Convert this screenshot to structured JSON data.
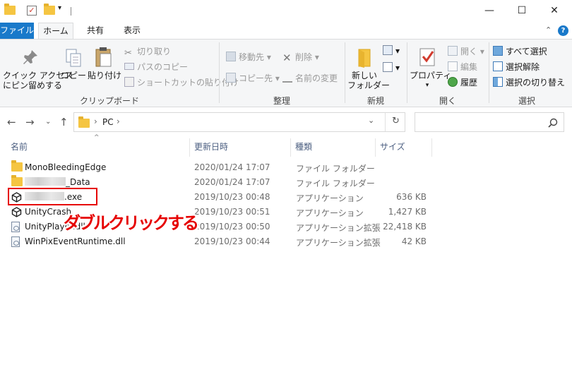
{
  "window": {
    "minimize": "—",
    "maximize": "☐",
    "close": "✕"
  },
  "ribbon_tabs": {
    "file": "ファイル",
    "home": "ホーム",
    "share": "共有",
    "view": "表示",
    "expand": "⌃",
    "help": "?"
  },
  "ribbon": {
    "clipboard": {
      "label": "クリップボード",
      "pin_line1": "クイック アクセス",
      "pin_line2": "にピン留めする",
      "copy": "コピー",
      "paste": "貼り付け",
      "cut": "切り取り",
      "copy_path": "パスのコピー",
      "paste_shortcut": "ショートカットの貼り付け"
    },
    "organize": {
      "label": "整理",
      "move_to": "移動先",
      "copy_to": "コピー先",
      "delete": "削除",
      "rename": "名前の変更"
    },
    "new": {
      "label": "新規",
      "new_folder_line1": "新しい",
      "new_folder_line2": "フォルダー"
    },
    "open": {
      "label": "開く",
      "properties": "プロパティ",
      "open": "開く",
      "edit": "編集",
      "history": "履歴"
    },
    "select": {
      "label": "選択",
      "select_all": "すべて選択",
      "select_none": "選択解除",
      "invert": "選択の切り替え"
    }
  },
  "address": {
    "location": "PC",
    "separator": "›",
    "search_placeholder": ""
  },
  "columns": {
    "name": "名前",
    "modified": "更新日時",
    "type": "種類",
    "size": "サイズ"
  },
  "files": [
    {
      "name": "MonoBleedingEdge",
      "date": "2020/01/24 17:07",
      "type": "ファイル フォルダー",
      "size": ""
    },
    {
      "name": "_Data",
      "date": "2020/01/24 17:07",
      "type": "ファイル フォルダー",
      "size": ""
    },
    {
      "name": ".exe",
      "date": "2019/10/23 00:48",
      "type": "アプリケーション",
      "size": "636 KB"
    },
    {
      "name": "UnityCrash",
      "date": "2019/10/23 00:51",
      "type": "アプリケーション",
      "size": "1,427 KB"
    },
    {
      "name": "UnityPlayer.dll",
      "date": "2019/10/23 00:50",
      "type": "アプリケーション拡張",
      "size": "22,418 KB"
    },
    {
      "name": "WinPixEventRuntime.dll",
      "date": "2019/10/23 00:44",
      "type": "アプリケーション拡張",
      "size": "42 KB"
    }
  ],
  "annotation": "ダブルクリックする",
  "colors": {
    "accent": "#1979ca",
    "annotation": "#e60000",
    "folder": "#f5c542"
  }
}
